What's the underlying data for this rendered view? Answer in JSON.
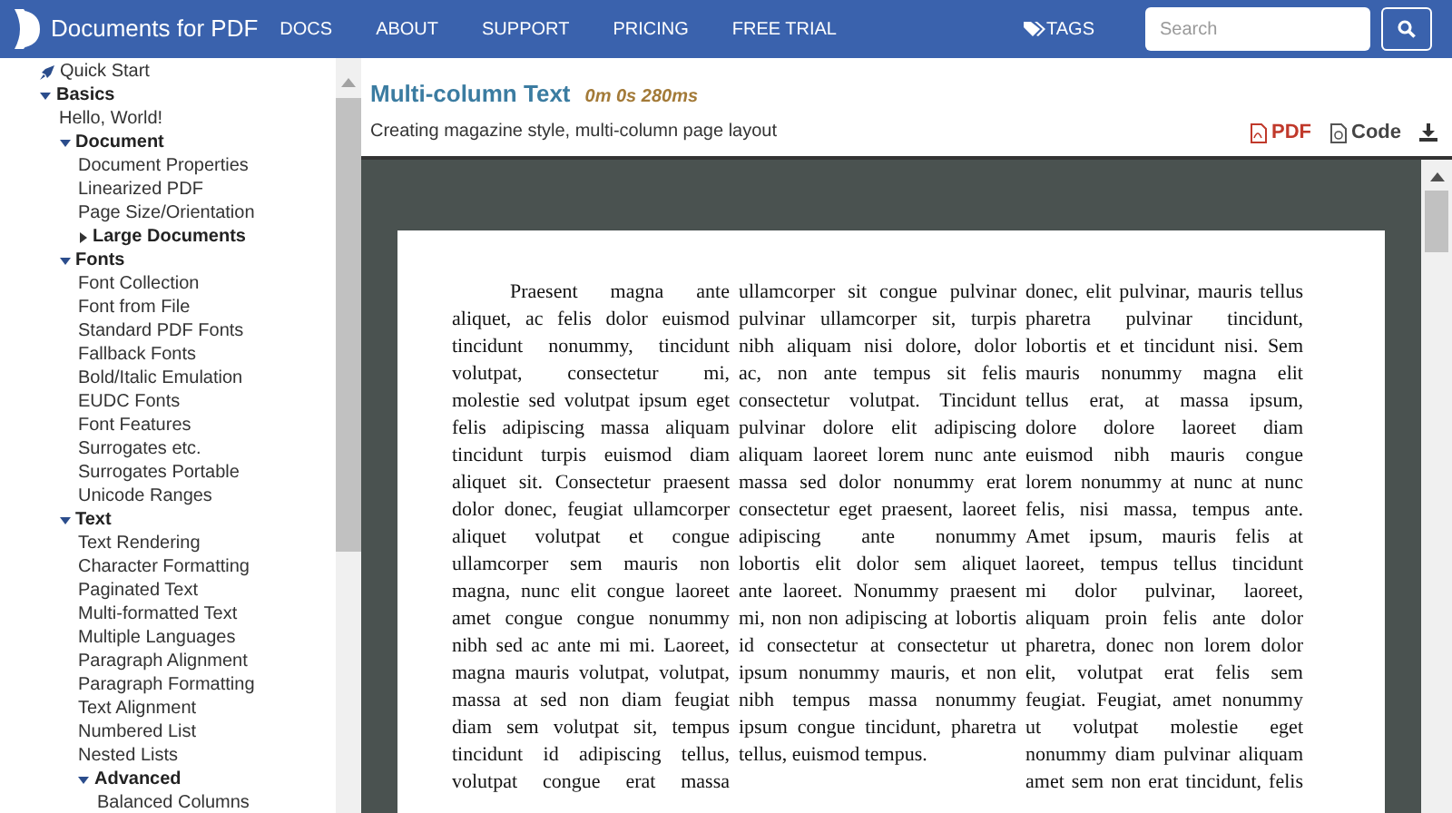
{
  "header": {
    "logo_text": "Documents for PDF",
    "nav": [
      "DOCS",
      "ABOUT",
      "SUPPORT",
      "PRICING",
      "FREE TRIAL"
    ],
    "tags_label": "TAGS",
    "search": {
      "placeholder": "Search"
    }
  },
  "sidebar": {
    "items": [
      {
        "label": "Quick Start",
        "kind": "shortcut"
      },
      {
        "label": "Basics",
        "kind": "group",
        "expanded": true,
        "children": [
          {
            "label": "Hello, World!",
            "kind": "page"
          },
          {
            "label": "Document",
            "kind": "group",
            "expanded": true,
            "children": [
              {
                "label": "Document Properties",
                "kind": "page"
              },
              {
                "label": "Linearized PDF",
                "kind": "page"
              },
              {
                "label": "Page Size/Orientation",
                "kind": "page"
              },
              {
                "label": "Large Documents",
                "kind": "group",
                "expanded": false
              }
            ]
          },
          {
            "label": "Fonts",
            "kind": "group",
            "expanded": true,
            "children": [
              {
                "label": "Font Collection",
                "kind": "page"
              },
              {
                "label": "Font from File",
                "kind": "page"
              },
              {
                "label": "Standard PDF Fonts",
                "kind": "page"
              },
              {
                "label": "Fallback Fonts",
                "kind": "page"
              },
              {
                "label": "Bold/Italic Emulation",
                "kind": "page"
              },
              {
                "label": "EUDC Fonts",
                "kind": "page"
              },
              {
                "label": "Font Features",
                "kind": "page"
              },
              {
                "label": "Surrogates etc.",
                "kind": "page"
              },
              {
                "label": "Surrogates Portable",
                "kind": "page"
              },
              {
                "label": "Unicode Ranges",
                "kind": "page"
              }
            ]
          },
          {
            "label": "Text",
            "kind": "group",
            "expanded": true,
            "children": [
              {
                "label": "Text Rendering",
                "kind": "page"
              },
              {
                "label": "Character Formatting",
                "kind": "page"
              },
              {
                "label": "Paginated Text",
                "kind": "page"
              },
              {
                "label": "Multi-formatted Text",
                "kind": "page"
              },
              {
                "label": "Multiple Languages",
                "kind": "page"
              },
              {
                "label": "Paragraph Alignment",
                "kind": "page"
              },
              {
                "label": "Paragraph Formatting",
                "kind": "page"
              },
              {
                "label": "Text Alignment",
                "kind": "page"
              },
              {
                "label": "Numbered List",
                "kind": "page"
              },
              {
                "label": "Nested Lists",
                "kind": "page"
              },
              {
                "label": "Advanced",
                "kind": "group",
                "expanded": true,
                "children": [
                  {
                    "label": "Balanced Columns",
                    "kind": "page"
                  }
                ]
              }
            ]
          }
        ]
      }
    ]
  },
  "sample": {
    "title": "Multi-column Text",
    "timing": "0m 0s 280ms",
    "description": "Creating magazine style, multi-column page layout",
    "actions": [
      {
        "label": "PDF",
        "kind": "pdf"
      },
      {
        "label": "Code",
        "kind": "code"
      },
      {
        "kind": "download"
      }
    ]
  },
  "document": {
    "columns": [
      {
        "paragraphs": [
          {
            "indented": true,
            "ends": false,
            "lines": [
              "Praesent magna ante",
              "aliquet, ac felis dolor euismod",
              "tincidunt nonummy, tincidunt",
              "volutpat, consectetur mi,",
              "molestie sed volutpat ipsum eget",
              "felis adipiscing massa aliquam",
              "tincidunt turpis euismod diam",
              "aliquet sit. Consectetur praesent",
              "dolor donec, feugiat ullamcorper",
              "aliquet volutpat et congue",
              "ullamcorper sem mauris non",
              "magna, nunc elit congue laoreet",
              "amet congue congue nonummy",
              "nibh sed ac ante mi mi. Laoreet,",
              "magna mauris volutpat, volutpat,",
              "massa at sed non diam feugiat",
              "diam sem volutpat sit, tempus",
              "tincidunt id adipiscing tellus,",
              "volutpat congue erat massa"
            ]
          }
        ]
      },
      {
        "paragraphs": [
          {
            "indented": false,
            "ends": true,
            "lines": [
              "ullamcorper sit congue pulvinar",
              "pulvinar ullamcorper sit, turpis",
              "nibh aliquam nisi dolore, dolor",
              "ac, non ante tempus sit felis",
              "consectetur volutpat. Tincidunt",
              "pulvinar dolore elit adipiscing",
              "aliquam laoreet lorem nunc ante",
              "massa sed dolor nonummy erat",
              "consectetur eget praesent, laoreet",
              "adipiscing ante nonummy",
              "lobortis elit dolor sem aliquet",
              "ante laoreet. Nonummy praesent",
              "mi, non non adipiscing at lobortis",
              "id consectetur at consectetur ut",
              "ipsum nonummy mauris, et non",
              "nibh tempus massa nonummy",
              "ipsum congue tincidunt, pharetra",
              "tellus, euismod tempus."
            ]
          }
        ]
      },
      {
        "paragraphs": [
          {
            "indented": false,
            "ends": false,
            "lines": [
              "donec, elit pulvinar, mauris tellus",
              "pharetra pulvinar tincidunt,",
              "lobortis et et tincidunt nisi. Sem",
              "mauris nonummy magna elit",
              "tellus erat, at massa ipsum,",
              "dolore dolore laoreet diam",
              "euismod nibh mauris congue",
              "lorem nonummy at nunc at nunc",
              "felis, nisi massa, tempus ante.",
              "Amet ipsum, mauris felis at",
              "laoreet, tempus tellus tincidunt",
              "mi dolor pulvinar, laoreet,",
              "aliquam proin felis ante dolor",
              "pharetra, donec non lorem dolor",
              "elit, volutpat erat felis sem",
              "feugiat. Feugiat, amet nonummy",
              "ut volutpat molestie eget",
              "nonummy diam pulvinar aliquam",
              "amet sem non erat tincidunt, felis"
            ]
          }
        ]
      }
    ]
  }
}
